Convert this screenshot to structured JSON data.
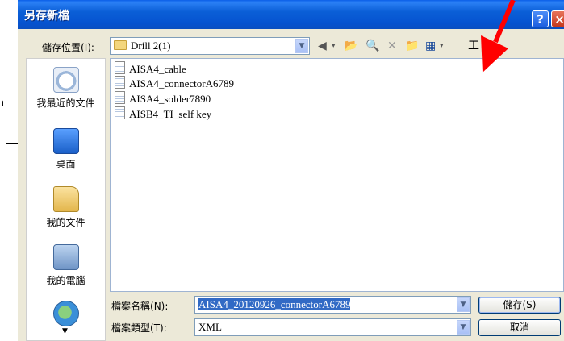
{
  "behind": {
    "char": "t"
  },
  "dialog": {
    "title": "另存新檔",
    "help_label": "?",
    "close_label": "×"
  },
  "location": {
    "label": "儲存位置",
    "hotkey": "(I):",
    "value": "Drill 2(1)"
  },
  "toolbar": {
    "tools_label": "工具(L)",
    "tools_visible": "工",
    "tools_suffix": "▾"
  },
  "places": [
    {
      "icon": "recent-docs-icon",
      "label": "我最近的文件"
    },
    {
      "icon": "desktop-icon",
      "label": "桌面"
    },
    {
      "icon": "my-documents-icon",
      "label": "我的文件"
    },
    {
      "icon": "my-computer-icon",
      "label": "我的電腦"
    },
    {
      "icon": "network-icon",
      "label": ""
    }
  ],
  "files": [
    {
      "icon": "xml-file-icon",
      "name": "AISA4_cable"
    },
    {
      "icon": "xml-file-icon",
      "name": "AISA4_connectorA6789"
    },
    {
      "icon": "xml-file-icon",
      "name": "AISA4_solder7890"
    },
    {
      "icon": "xml-file-icon",
      "name": "AISB4_TI_self key"
    }
  ],
  "filename": {
    "label": "檔案名稱",
    "hotkey": "(N):",
    "value": "AISA4_20120926_connectorA6789"
  },
  "filetype": {
    "label": "檔案類型",
    "hotkey": "(T):",
    "value": "XML"
  },
  "buttons": {
    "save": "儲存(S)",
    "cancel": "取消"
  },
  "colors": {
    "titlebar": "#0653d0",
    "annotation_arrow": "#ff0000",
    "selection": "#316ac5"
  }
}
